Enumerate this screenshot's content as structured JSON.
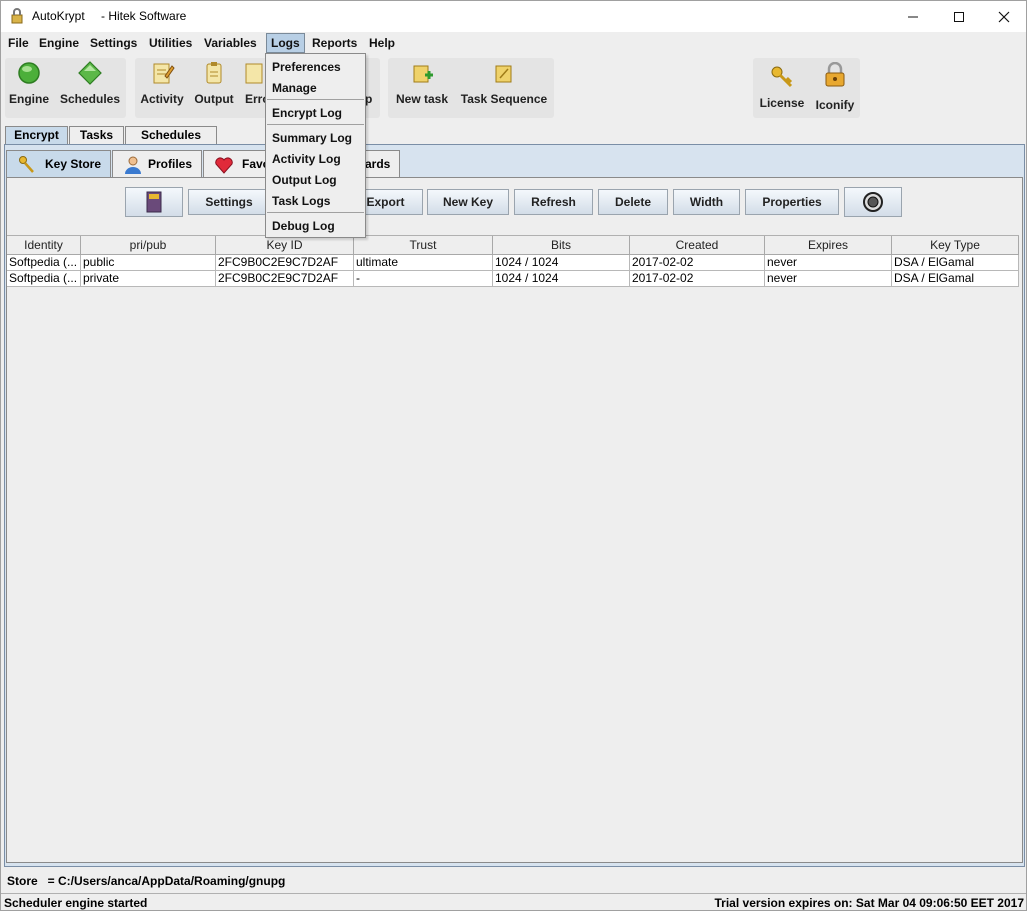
{
  "window": {
    "title": "AutoKrypt",
    "subtitle": "- Hitek Software",
    "minimize_glyph": "—",
    "maximize_glyph": "☐",
    "close_glyph": "✕"
  },
  "menubar": {
    "items": [
      "File",
      "Engine",
      "Settings",
      "Utilities",
      "Variables",
      "Logs",
      "Reports",
      "Help"
    ],
    "active": "Logs"
  },
  "toolbar": {
    "engine": "Engine",
    "schedules": "Schedules",
    "activity": "Activity",
    "output": "Output",
    "errors": "Erro",
    "help_partial": "p",
    "new_task": "New task",
    "task_sequence": "Task Sequence",
    "license": "License",
    "iconify": "Iconify"
  },
  "outer_tabs": [
    "Encrypt",
    "Tasks",
    "Schedules"
  ],
  "inner_tabs": {
    "key_store": "Key Store",
    "profiles": "Profiles",
    "favorites_partial": "Favo",
    "wizards_partial": "ards"
  },
  "key_buttons": {
    "settings": "Settings",
    "export": "Export",
    "new_key": "New Key",
    "refresh": "Refresh",
    "delete": "Delete",
    "width": "Width",
    "properties": "Properties"
  },
  "logs_menu": {
    "items": [
      "Preferences",
      "Manage",
      "Encrypt Log",
      "Summary Log",
      "Activity Log",
      "Output Log",
      "Task Logs",
      "Debug Log"
    ]
  },
  "table": {
    "columns": [
      "Identity",
      "pri/pub",
      "Key ID",
      "Trust",
      "Bits",
      "Created",
      "Expires",
      "Key Type"
    ],
    "rows": [
      [
        "Softpedia (...",
        "public",
        "2FC9B0C2E9C7D2AF",
        "ultimate",
        "1024 / 1024",
        "2017-02-02",
        "never",
        "DSA / ElGamal"
      ],
      [
        "Softpedia (...",
        "private",
        "2FC9B0C2E9C7D2AF",
        "-",
        "1024 / 1024",
        "2017-02-02",
        "never",
        "DSA / ElGamal"
      ]
    ]
  },
  "store_line": "Store   = C:/Users/anca/AppData/Roaming/gnupg",
  "status": {
    "left": "Scheduler engine started",
    "right": "Trial version expires on: Sat Mar 04 09:06:50 EET 2017"
  },
  "colors": {
    "menu_highlight": "#b8cfe5",
    "tab_selected": "#c8daea",
    "panel_blue": "#d7e3ef"
  }
}
